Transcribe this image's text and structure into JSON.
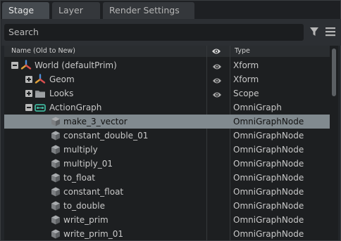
{
  "tabs": [
    {
      "label": "Stage"
    },
    {
      "label": "Layer"
    },
    {
      "label": "Render Settings"
    }
  ],
  "search": {
    "placeholder": "Search"
  },
  "columns": {
    "name": "Name (Old to New)",
    "type": "Type"
  },
  "rows": [
    {
      "label": "World (defaultPrim)",
      "type": "Xform",
      "icon": "xform-icon",
      "expander": "minus",
      "visible": true
    },
    {
      "label": "Geom",
      "type": "Xform",
      "icon": "xform-icon",
      "expander": "plus",
      "visible": true
    },
    {
      "label": "Looks",
      "type": "Scope",
      "icon": "folder-icon",
      "expander": "plus",
      "visible": true
    },
    {
      "label": "ActionGraph",
      "type": "OmniGraph",
      "icon": "omnigraph-icon",
      "expander": "minus",
      "visible": false
    },
    {
      "label": "make_3_vector",
      "type": "OmniGraphNode",
      "icon": "cube-icon",
      "selected": true
    },
    {
      "label": "constant_double_01",
      "type": "OmniGraphNode",
      "icon": "cube-icon"
    },
    {
      "label": "multiply",
      "type": "OmniGraphNode",
      "icon": "cube-icon"
    },
    {
      "label": "multiply_01",
      "type": "OmniGraphNode",
      "icon": "cube-icon"
    },
    {
      "label": "to_float",
      "type": "OmniGraphNode",
      "icon": "cube-icon"
    },
    {
      "label": "constant_float",
      "type": "OmniGraphNode",
      "icon": "cube-icon"
    },
    {
      "label": "to_double",
      "type": "OmniGraphNode",
      "icon": "cube-icon"
    },
    {
      "label": "write_prim",
      "type": "OmniGraphNode",
      "icon": "cube-icon"
    },
    {
      "label": "write_prim_01",
      "type": "OmniGraphNode",
      "icon": "cube-icon"
    }
  ]
}
